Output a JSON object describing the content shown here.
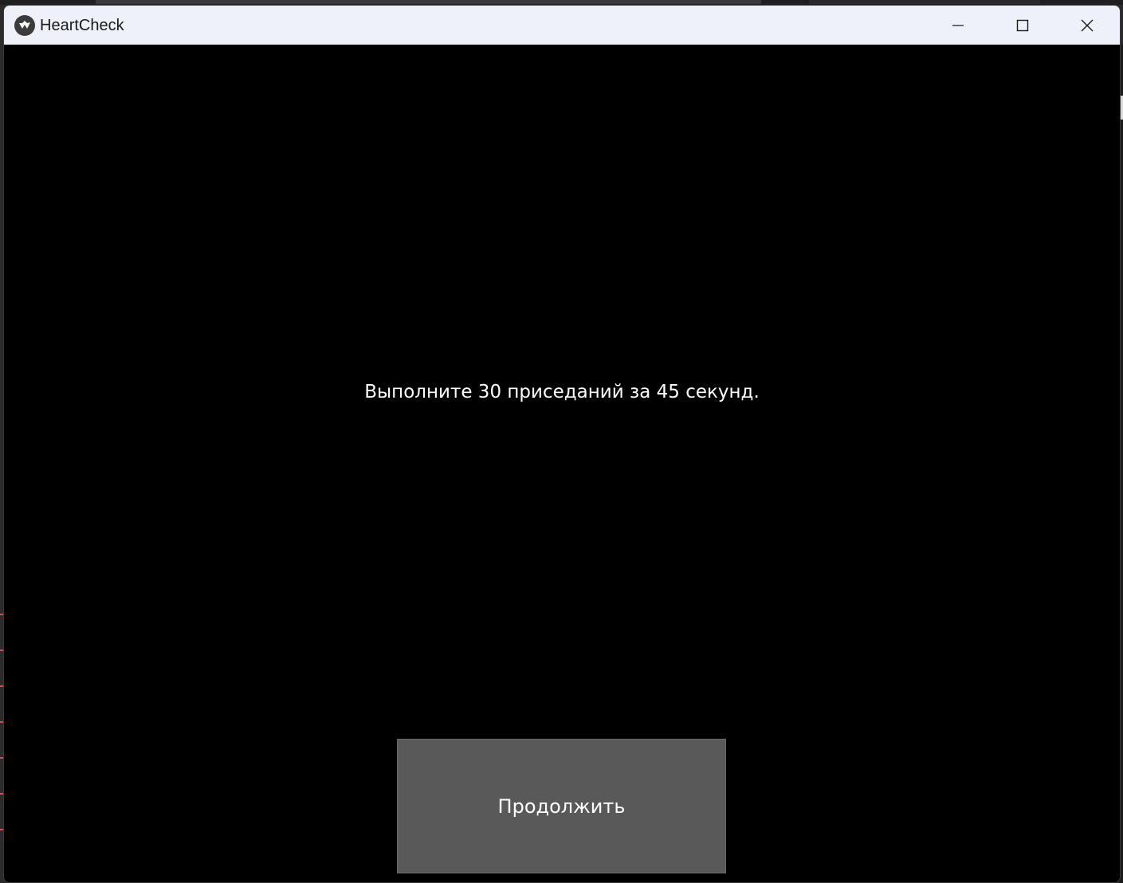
{
  "window": {
    "title": "HeartCheck",
    "controls": {
      "minimize": "minimize-icon",
      "maximize": "maximize-icon",
      "close": "close-icon"
    }
  },
  "main": {
    "instruction": "Выполните 30 приседаний за 45 секунд.",
    "continue_label": "Продолжить"
  },
  "colors": {
    "titlebar_bg": "#eef1f9",
    "content_bg": "#000000",
    "button_bg": "#595959",
    "text": "#ffffff"
  }
}
